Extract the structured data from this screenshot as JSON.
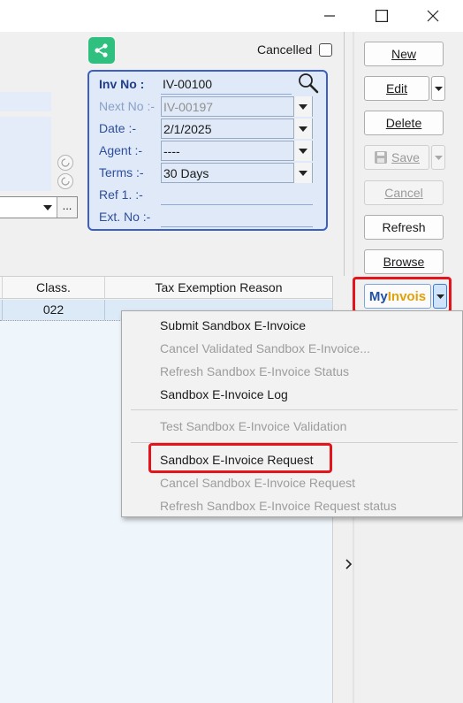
{
  "window": {
    "controls": {
      "minimize_icon": "minimize-icon",
      "maximize_icon": "maximize-icon",
      "close_icon": "close-icon"
    }
  },
  "header": {
    "cancelled_label": "Cancelled",
    "cancelled_checked": false,
    "share_icon": "share-icon",
    "share_color": "#2fbf7f"
  },
  "invoice": {
    "inv_no_label": "Inv No :",
    "inv_no": "IV-00100",
    "next_no_label": "Next No :-",
    "next_no": "IV-00197",
    "date_label": "Date :-",
    "date": "2/1/2025",
    "agent_label": "Agent :-",
    "agent": "----",
    "terms_label": "Terms :-",
    "terms": "30 Days",
    "ref1_label": "Ref 1. :-",
    "ref1": "",
    "ext_no_label": "Ext. No :-",
    "ext_no": "",
    "panel_border_color": "#3d5fc4"
  },
  "left_combo": {
    "more_label": "..."
  },
  "grid": {
    "columns": [
      "Class.",
      "Tax Exemption Reason"
    ],
    "rows": [
      {
        "class": "022",
        "tax_exemption_reason": ""
      }
    ]
  },
  "toolbar": {
    "new_label": "New",
    "edit_label": "Edit",
    "delete_label": "Delete",
    "save_label": "Save",
    "cancel_label": "Cancel",
    "refresh_label": "Refresh",
    "browse_label": "Browse",
    "myinvois_my": "My",
    "myinvois_invois": "Invois",
    "myinvois_brand_colors": [
      "#1f4fa8",
      "#e0a10b"
    ],
    "highlight_color": "#e3141b"
  },
  "dropdown_menu": {
    "items": [
      {
        "label": "Submit Sandbox E-Invoice",
        "enabled": true
      },
      {
        "label": "Cancel Validated Sandbox E-Invoice...",
        "enabled": false
      },
      {
        "label": "Refresh Sandbox E-Invoice Status",
        "enabled": false
      },
      {
        "label": "Sandbox E-Invoice Log",
        "enabled": true
      },
      {
        "label": "Test Sandbox E-Invoice Validation",
        "enabled": false
      },
      {
        "label": "Sandbox E-Invoice Request",
        "enabled": true,
        "highlighted": true
      },
      {
        "label": "Cancel Sandbox E-Invoice Request",
        "enabled": false
      },
      {
        "label": "Refresh Sandbox E-Invoice Request status",
        "enabled": false
      }
    ]
  }
}
